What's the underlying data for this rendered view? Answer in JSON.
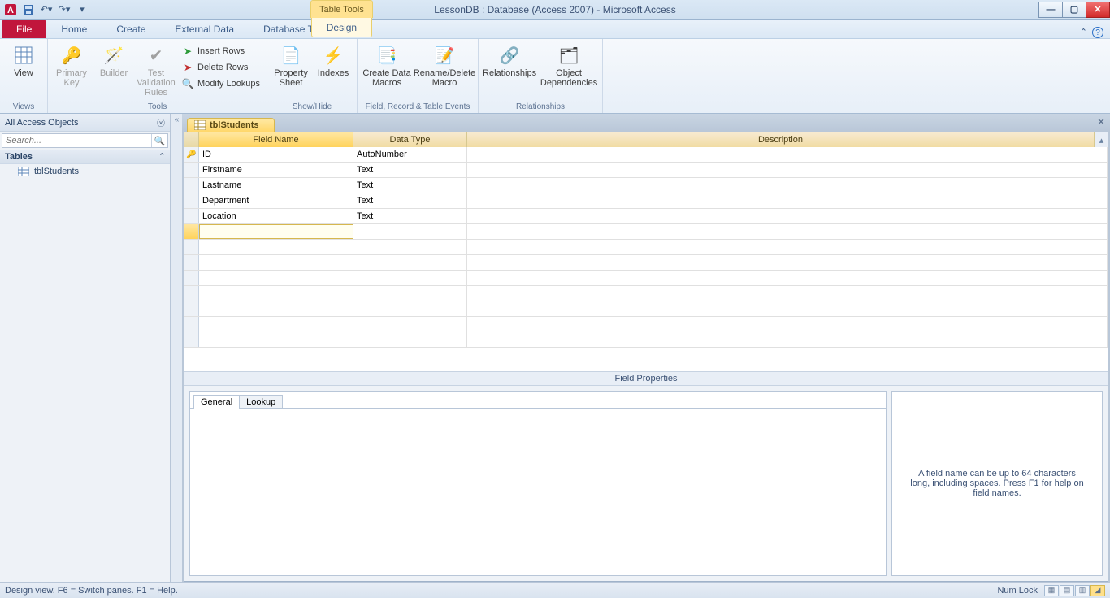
{
  "title": "LessonDB : Database (Access 2007)  -  Microsoft Access",
  "contextual": {
    "group": "Table Tools",
    "tab": "Design"
  },
  "tabs": {
    "file": "File",
    "home": "Home",
    "create": "Create",
    "external": "External Data",
    "dbtools": "Database Tools"
  },
  "ribbon": {
    "views": {
      "view": "View",
      "label": "Views"
    },
    "tools": {
      "pk": "Primary\nKey",
      "builder": "Builder",
      "test": "Test Validation\nRules",
      "insert": "Insert Rows",
      "delete": "Delete Rows",
      "modify": "Modify Lookups",
      "label": "Tools"
    },
    "showhide": {
      "propsheet": "Property\nSheet",
      "indexes": "Indexes",
      "label": "Show/Hide"
    },
    "events": {
      "createmacros": "Create Data\nMacros",
      "renamedelete": "Rename/Delete\nMacro",
      "label": "Field, Record & Table Events"
    },
    "rel": {
      "relationships": "Relationships",
      "objdep": "Object\nDependencies",
      "label": "Relationships"
    }
  },
  "nav": {
    "header": "All Access Objects",
    "search_placeholder": "Search...",
    "cat_tables": "Tables",
    "items": [
      {
        "label": "tblStudents"
      }
    ]
  },
  "doc": {
    "tab": "tblStudents"
  },
  "grid": {
    "headers": {
      "fieldname": "Field Name",
      "datatype": "Data Type",
      "description": "Description"
    },
    "rows": [
      {
        "name": "ID",
        "type": "AutoNumber",
        "pk": true
      },
      {
        "name": "Firstname",
        "type": "Text"
      },
      {
        "name": "Lastname",
        "type": "Text"
      },
      {
        "name": "Department",
        "type": "Text"
      },
      {
        "name": "Location",
        "type": "Text"
      }
    ]
  },
  "fieldprops": {
    "label": "Field Properties",
    "tabs": {
      "general": "General",
      "lookup": "Lookup"
    },
    "hint": "A field name can be up to 64 characters long, including spaces. Press F1 for help on field names."
  },
  "status": {
    "left": "Design view.  F6 = Switch panes.  F1 = Help.",
    "numlock": "Num Lock"
  }
}
